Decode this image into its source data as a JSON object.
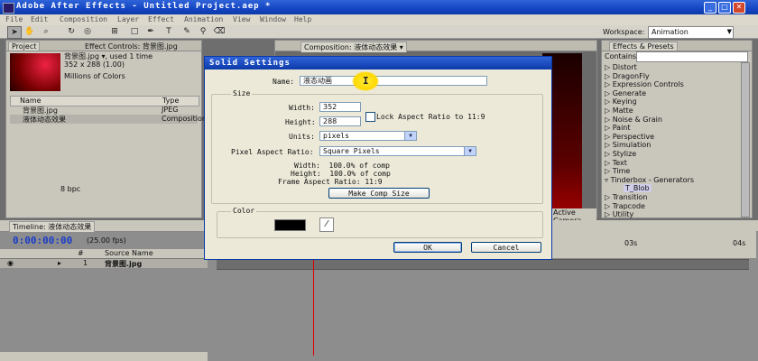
{
  "app": {
    "title": "Adobe After Effects - Untitled Project.aep *"
  },
  "menu": [
    "File",
    "Edit",
    "Composition",
    "Layer",
    "Effect",
    "Animation",
    "View",
    "Window",
    "Help"
  ],
  "toolbar": {
    "workspace_label": "Workspace:",
    "workspace_value": "Animation"
  },
  "project_panel": {
    "tab_project": "Project",
    "tab_effect_controls": "Effect Controls: 背景图.jpg",
    "info_line1": "背景图.jpg ▾, used 1 time",
    "info_line2": "352 x 288 (1.00)",
    "info_line3": "Millions of Colors",
    "col_name": "Name",
    "col_type": "Type",
    "items": [
      {
        "name": "背景图.jpg",
        "type": "JPEG"
      },
      {
        "name": "液体动态效果",
        "type": "Composition"
      }
    ],
    "bit_depth": "8 bpc"
  },
  "comp_panel": {
    "tab": "Composition: 液体动态效果 ▾",
    "camera": "Active Camera"
  },
  "effects_panel": {
    "tab": "Effects & Presets",
    "contains_label": "Contains:",
    "items": [
      "Distort",
      "DragonFly",
      "Expression Controls",
      "Generate",
      "Keying",
      "Matte",
      "Noise & Grain",
      "Paint",
      "Perspective",
      "Simulation",
      "Stylize",
      "Text",
      "Time",
      "Tinderbox - Generators",
      "T_Blob",
      "Transition",
      "Trapcode",
      "Utility"
    ]
  },
  "timeline": {
    "tab": "Timeline: 液体动态效果",
    "timecode": "0:00:00:00",
    "fps": "(25.00 fps)",
    "col_hash": "#",
    "col_source": "Source Name",
    "layer_index": "1",
    "layer_name": "背景图.jpg",
    "ruler": [
      "03s",
      "04s"
    ]
  },
  "dialog": {
    "title": "Solid Settings",
    "name_label": "Name:",
    "name_value": "液态动画",
    "size_group": "Size",
    "width_label": "Width:",
    "width_value": "352",
    "height_label": "Height:",
    "height_value": "288",
    "lock_label": "Lock Aspect Ratio to 11:9",
    "units_label": "Units:",
    "units_value": "pixels",
    "par_label": "Pixel Aspect Ratio:",
    "par_value": "Square Pixels",
    "info_width": "Width:  100.0% of comp",
    "info_height": "Height:  100.0% of comp",
    "info_frame": "Frame Aspect Ratio: 11:9",
    "make_comp_size": "Make Comp Size",
    "color_group": "Color",
    "ok": "OK",
    "cancel": "Cancel"
  },
  "colors": {
    "accent": "#0c3aa8",
    "timecode": "#1a3cc8",
    "swatch": "#000000"
  }
}
